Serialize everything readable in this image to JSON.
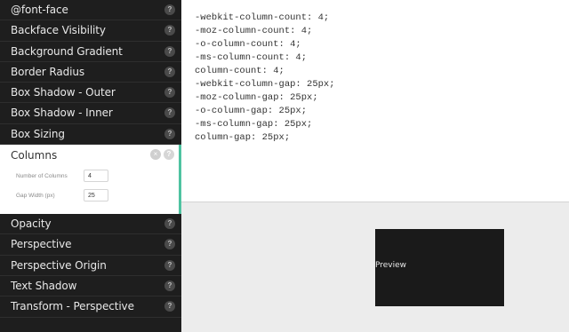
{
  "sidebar": {
    "items_top": [
      {
        "label": "@font-face"
      },
      {
        "label": "Backface Visibility"
      },
      {
        "label": "Background Gradient"
      },
      {
        "label": "Border Radius"
      },
      {
        "label": "Box Shadow - Outer"
      },
      {
        "label": "Box Shadow - Inner"
      },
      {
        "label": "Box Sizing"
      }
    ],
    "active": {
      "title": "Columns",
      "close_icon": "×",
      "help_icon": "?",
      "fields": [
        {
          "label": "Number of Columns",
          "value": "4"
        },
        {
          "label": "Gap Width (px)",
          "value": "25"
        }
      ]
    },
    "items_bottom": [
      {
        "label": "Opacity"
      },
      {
        "label": "Perspective"
      },
      {
        "label": "Perspective Origin"
      },
      {
        "label": "Text Shadow"
      },
      {
        "label": "Transform - Perspective"
      }
    ],
    "help_icon": "?"
  },
  "code": {
    "text": "-webkit-column-count: 4;\n-moz-column-count: 4;\n-o-column-count: 4;\n-ms-column-count: 4;\ncolumn-count: 4;\n-webkit-column-gap: 25px;\n-moz-column-gap: 25px;\n-o-column-gap: 25px;\n-ms-column-gap: 25px;\ncolumn-gap: 25px;"
  },
  "preview": {
    "label": "Preview"
  },
  "colors": {
    "sidebar_bg": "#1e1e1e",
    "accent": "#4fc3a1",
    "preview_bg": "#1a1a1a"
  }
}
